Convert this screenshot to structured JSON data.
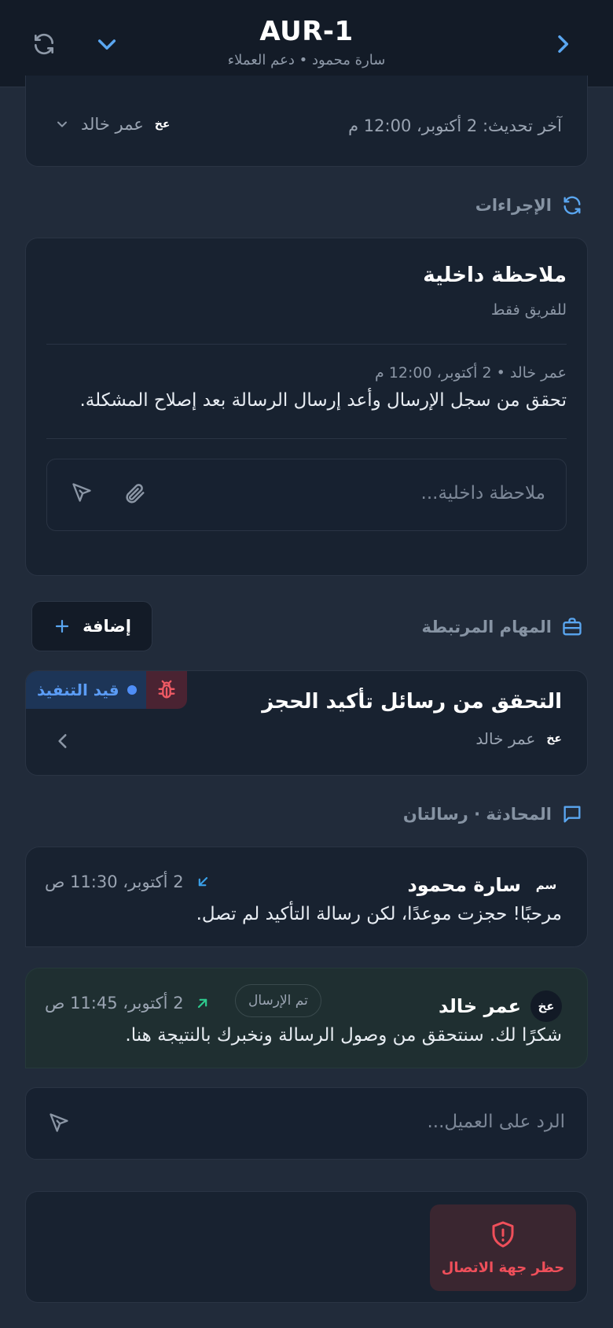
{
  "header": {
    "title": "AUR-1",
    "subtitle": "سارة محمود • دعم العملاء"
  },
  "details": {
    "last_updated": "آخر تحديث: 2 أكتوبر، 12:00 م",
    "assignee_initials": "عخ",
    "assignee_name": "عمر خالد"
  },
  "actions": {
    "section_label": "الإجراءات",
    "internal_note": {
      "title": "ملاحظة داخلية",
      "subtitle": "للفريق فقط",
      "note_meta": "عمر خالد • 2 أكتوبر، 12:00 م",
      "note_body": "تحقق من سجل الإرسال وأعد إرسال الرسالة بعد إصلاح المشكلة.",
      "input_placeholder": "ملاحظة داخلية..."
    }
  },
  "linked_tasks": {
    "section_label": "المهام المرتبطة",
    "add_label": "إضافة",
    "tasks": [
      {
        "title": "التحقق من رسائل تأكيد الحجز",
        "status": "قيد التنفيذ",
        "assignee_initials": "عخ",
        "assignee_name": "عمر خالد"
      }
    ]
  },
  "conversation": {
    "section_label": "المحادثة · رسالتان",
    "messages": [
      {
        "direction": "incoming",
        "sender_initials": "سم",
        "sender": "سارة محمود",
        "time": "2 أكتوبر، 11:30 ص",
        "body": "مرحبًا! حجزت موعدًا، لكن رسالة التأكيد لم تصل."
      },
      {
        "direction": "outgoing",
        "sender_initials": "عخ",
        "sender": "عمر خالد",
        "status": "تم الإرسال",
        "time": "2 أكتوبر، 11:45 ص",
        "body": "شكرًا لك. سنتحقق من وصول الرسالة ونخبرك بالنتيجة هنا."
      }
    ],
    "reply_placeholder": "الرد على العميل..."
  },
  "block_contact": {
    "label": "حظر جهة الاتصال"
  },
  "colors": {
    "background": "#212b3a",
    "card": "#182230",
    "accent": "#4f8ef7",
    "danger": "#ef4f5a",
    "incoming_arrow": "#3aa0e8",
    "outgoing_arrow": "#2ecc8f"
  },
  "icons": {
    "refresh": "refresh-icon",
    "collapse": "chevron-down-icon",
    "forward": "chevron-right-icon",
    "actions": "refresh-icon",
    "tasks": "briefcase-icon",
    "conversation": "message-icon",
    "attach": "paperclip-icon",
    "send": "send-icon",
    "bug": "bug-icon",
    "block": "shield-alert-icon"
  }
}
